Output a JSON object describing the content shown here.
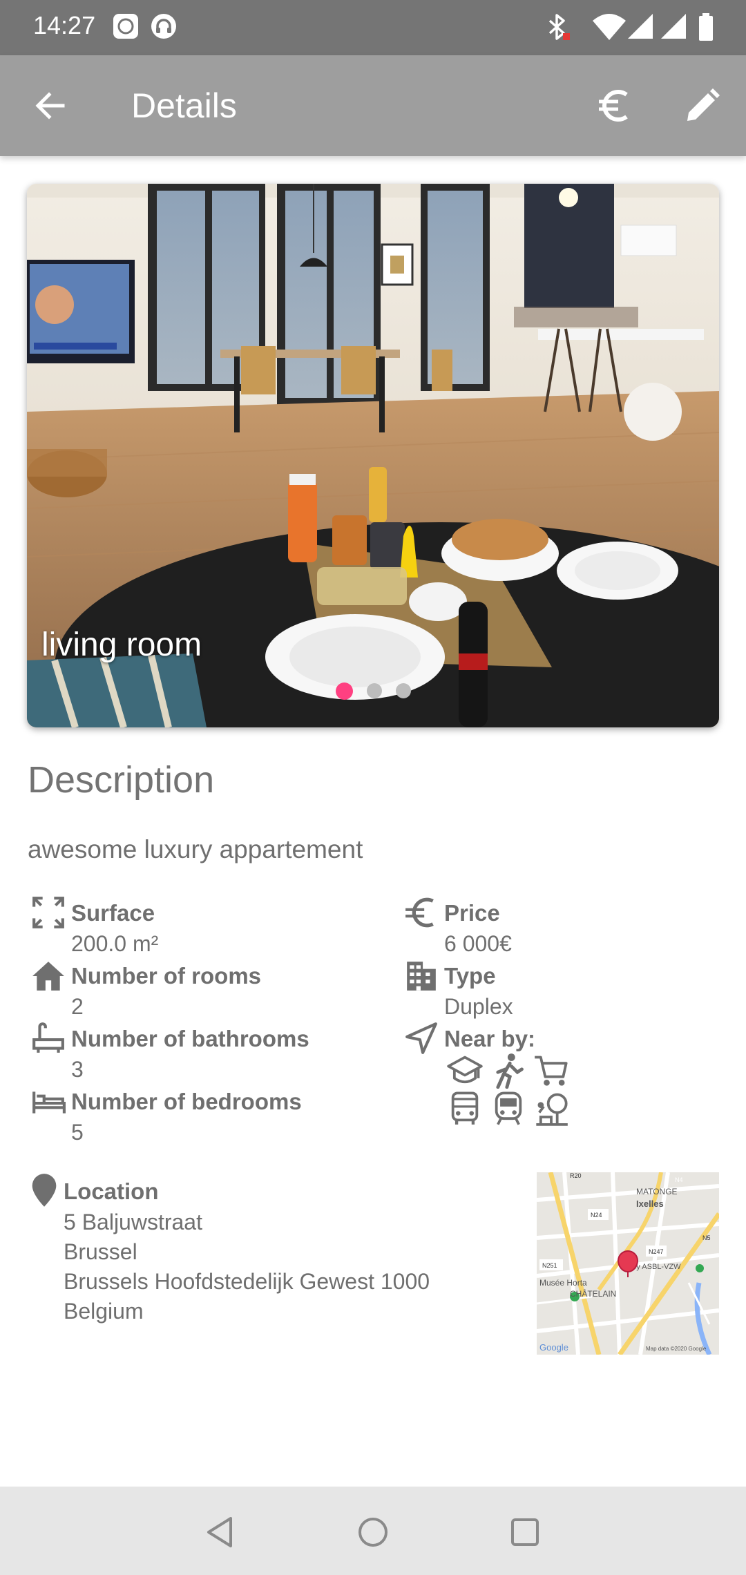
{
  "status_bar": {
    "time": "14:27",
    "icons": [
      "notification-app-icon",
      "headset-app-icon",
      "bluetooth-icon",
      "wifi-icon",
      "signal-icon",
      "signal-icon",
      "battery-icon"
    ]
  },
  "app_bar": {
    "title": "Details",
    "back_icon": "arrow-back-icon",
    "currency_icon": "euro-icon",
    "edit_icon": "pencil-icon"
  },
  "carousel": {
    "caption": "living room",
    "page_count": 3,
    "active_index": 0,
    "accent_color": "#ff4081"
  },
  "description": {
    "heading": "Description",
    "text": "awesome luxury appartement"
  },
  "details": {
    "surface": {
      "label": "Surface",
      "value": "200.0 m²",
      "icon": "fullscreen-icon"
    },
    "rooms": {
      "label": "Number of rooms",
      "value": "2",
      "icon": "home-icon"
    },
    "bathrooms": {
      "label": "Number of bathrooms",
      "value": "3",
      "icon": "bathtub-icon"
    },
    "bedrooms": {
      "label": "Number of bedrooms",
      "value": "5",
      "icon": "bed-icon"
    },
    "price": {
      "label": "Price",
      "value": "6 000€",
      "icon": "euro-icon"
    },
    "type": {
      "label": "Type",
      "value": "Duplex",
      "icon": "building-icon"
    },
    "near_by": {
      "label": "Near by:",
      "icon": "navigation-icon",
      "items": [
        "school-icon",
        "park-walk-icon",
        "shopping-cart-icon",
        "bus-icon",
        "train-icon",
        "playground-icon"
      ]
    }
  },
  "location": {
    "label": "Location",
    "icon": "place-icon",
    "street": "5 Baljuwstraat",
    "city": "Brussel",
    "region": "Brussels Hoofdstedelijk Gewest 1000",
    "country": "Belgium"
  },
  "map": {
    "labels": [
      "MATONGE",
      "Ixelles",
      "Musée Horta",
      "CHÂTELAIN",
      "ogey ASBL-VZW",
      "N4",
      "N24",
      "N251",
      "N247",
      "N5",
      "R20"
    ],
    "logo": "Google",
    "attribution": "Map data ©2020 Google"
  },
  "nav_bar": {
    "icons": [
      "nav-back-icon",
      "nav-home-icon",
      "nav-recents-icon"
    ]
  }
}
